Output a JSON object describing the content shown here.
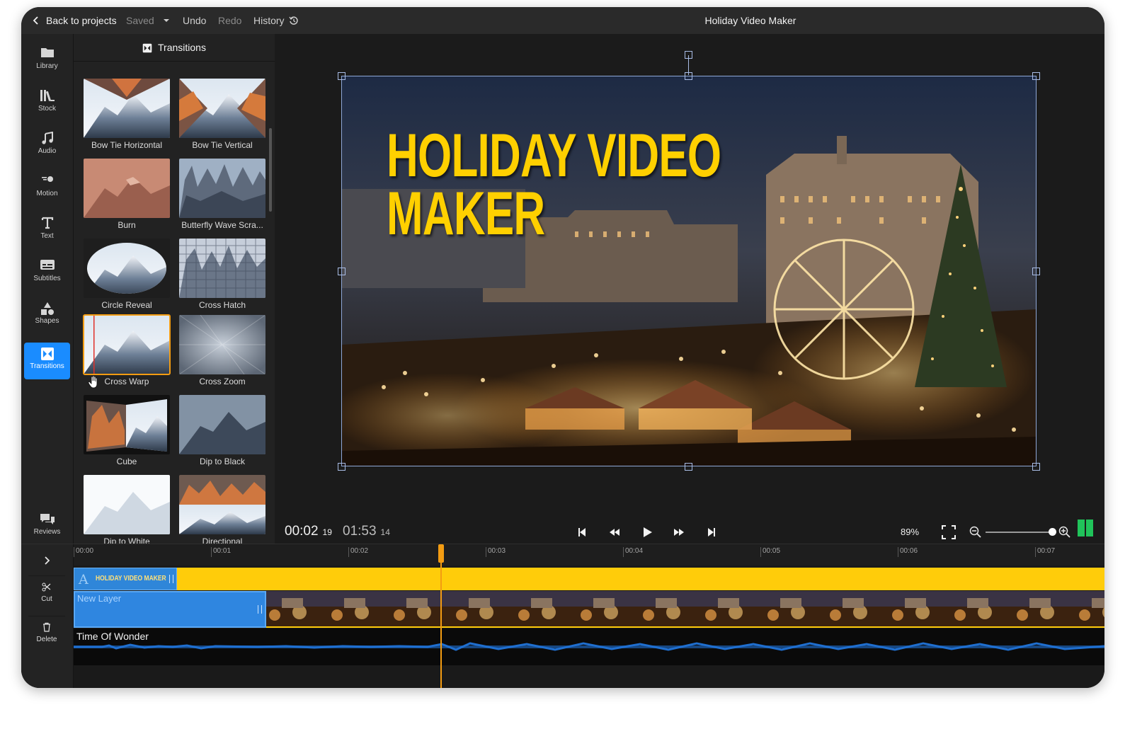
{
  "topbar": {
    "back_label": "Back to projects",
    "saved_label": "Saved",
    "undo_label": "Undo",
    "redo_label": "Redo",
    "history_label": "History",
    "app_title": "Holiday Video Maker"
  },
  "sidebar": {
    "items": [
      {
        "label": "Library",
        "icon": "folder-icon"
      },
      {
        "label": "Stock",
        "icon": "books-icon"
      },
      {
        "label": "Audio",
        "icon": "music-note-icon"
      },
      {
        "label": "Motion",
        "icon": "motion-icon"
      },
      {
        "label": "Text",
        "icon": "text-icon"
      },
      {
        "label": "Subtitles",
        "icon": "subtitles-icon"
      },
      {
        "label": "Shapes",
        "icon": "shapes-icon"
      },
      {
        "label": "Transitions",
        "icon": "transitions-icon",
        "active": true
      },
      {
        "label": "Reviews",
        "icon": "chat-bubbles-icon"
      }
    ]
  },
  "panel": {
    "title": "Transitions",
    "transitions": [
      {
        "name": "Bow Tie Horizontal"
      },
      {
        "name": "Bow Tie Vertical"
      },
      {
        "name": "Burn"
      },
      {
        "name": "Butterfly Wave Scra..."
      },
      {
        "name": "Circle Reveal"
      },
      {
        "name": "Cross Hatch"
      },
      {
        "name": "Cross Warp",
        "selected": true
      },
      {
        "name": "Cross Zoom"
      },
      {
        "name": "Cube"
      },
      {
        "name": "Dip to Black"
      },
      {
        "name": "Dip to White"
      },
      {
        "name": "Directional"
      }
    ]
  },
  "preview": {
    "title_line1": "HOLIDAY VIDEO",
    "title_line2": "MAKER",
    "current_time": "00:02",
    "current_frame": "19",
    "total_time": "01:53",
    "total_frame": "14",
    "zoom": "89%",
    "zoom_level": 0.97
  },
  "timeline": {
    "expand_icon": "chevron-right-icon",
    "cut_label": "Cut",
    "delete_label": "Delete",
    "ruler": [
      "00:00",
      "00:01",
      "00:02",
      "00:03",
      "00:04",
      "00:05",
      "00:06",
      "00:07"
    ],
    "title_clip": "HOLIDAY VIDEO MAKER",
    "layer_clip": "New Layer",
    "audio_clip": "Time Of Wonder"
  },
  "colors": {
    "accent": "#1a8cff",
    "playhead": "#f39c12",
    "title_text": "#ffd000",
    "title_track": "#ffcc0a",
    "meter": "#20c35a"
  }
}
